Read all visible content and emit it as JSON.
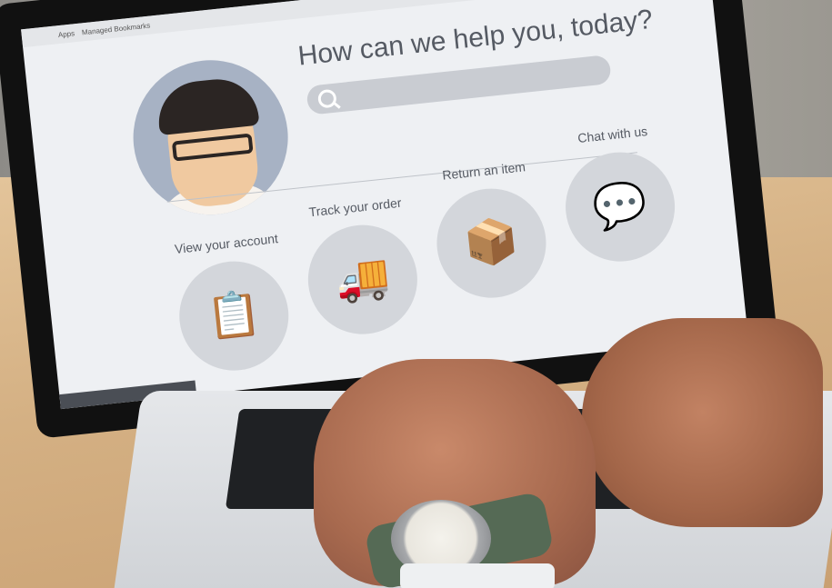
{
  "browser": {
    "apps_label": "Apps",
    "bookmarks_label": "Managed Bookmarks"
  },
  "support_page": {
    "headline": "How can we help you, today?",
    "options": [
      {
        "label": "View your account",
        "icon": "clipboard-icon"
      },
      {
        "label": "Track your order",
        "icon": "delivery-truck-icon"
      },
      {
        "label": "Return an item",
        "icon": "open-box-icon"
      },
      {
        "label": "Chat with us",
        "icon": "chat-bubbles-icon"
      }
    ]
  }
}
